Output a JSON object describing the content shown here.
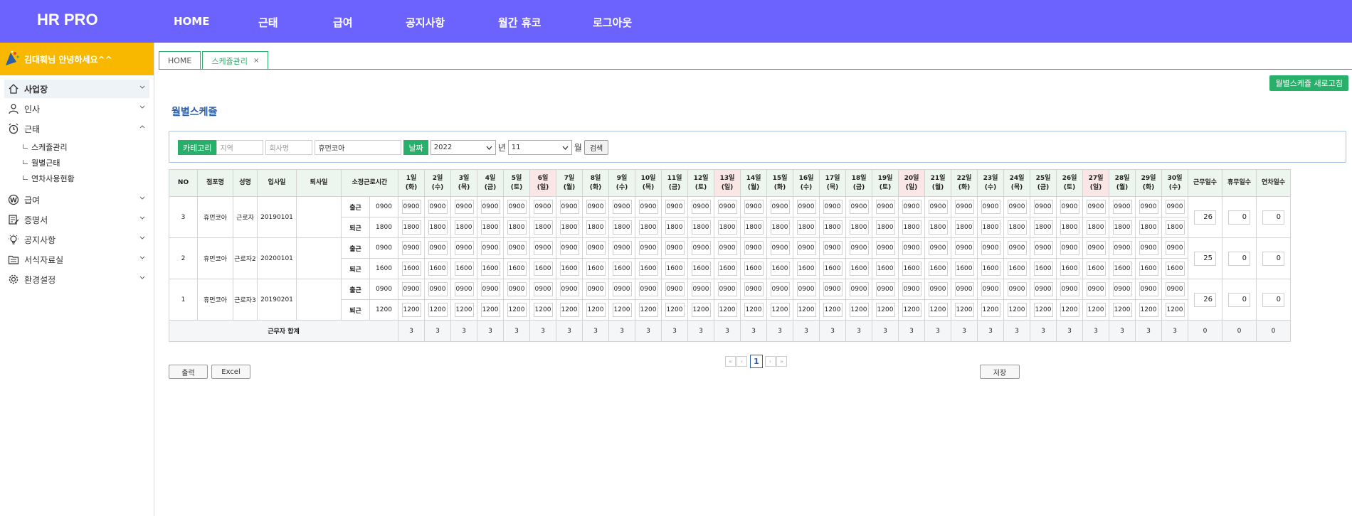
{
  "brand": "HR PRO",
  "topnav": [
    "HOME",
    "근태",
    "급여",
    "공지사항",
    "월간 휴코",
    "로그아웃"
  ],
  "sidebar": {
    "greeting": "김대훼님 안녕하세요^^",
    "items": [
      {
        "label": "사업장",
        "icon": "home-icon",
        "active": true
      },
      {
        "label": "인사",
        "icon": "person-icon"
      },
      {
        "label": "근태",
        "icon": "alarm-clock-icon",
        "expanded": true
      },
      {
        "label": "급여",
        "icon": "won-icon"
      },
      {
        "label": "증명서",
        "icon": "document-edit-icon"
      },
      {
        "label": "공지사항",
        "icon": "bulb-icon"
      },
      {
        "label": "서식자료실",
        "icon": "folder-icon"
      },
      {
        "label": "환경설정",
        "icon": "gear-icon"
      }
    ],
    "subitems": [
      "스케쥴관리",
      "월별근태",
      "연차사용현황"
    ]
  },
  "tabs": [
    {
      "label": "HOME"
    },
    {
      "label": "스케쥴관리",
      "close": "×"
    }
  ],
  "refresh_button": "월별스케쥴 새로고침",
  "page_title": "월별스케쥴",
  "search": {
    "category_label": "카테고리",
    "region_placeholder": "지역",
    "company_placeholder": "회사명",
    "store_value": "휴먼코아",
    "date_label": "날짜",
    "year_value": "2022",
    "year_suffix": "년",
    "month_value": "11",
    "month_suffix": "월",
    "search_button": "검색"
  },
  "table": {
    "headers": {
      "no": "NO",
      "store": "점포명",
      "name": "성명",
      "hire": "입사일",
      "leave": "퇴사일",
      "standard": "소정근로시간",
      "work_days": "근무일수",
      "off_days": "휴무일수",
      "annual_days": "연차일수"
    },
    "days": [
      {
        "d": "1일",
        "w": "(화)"
      },
      {
        "d": "2일",
        "w": "(수)"
      },
      {
        "d": "3일",
        "w": "(목)"
      },
      {
        "d": "4일",
        "w": "(금)"
      },
      {
        "d": "5일",
        "w": "(토)"
      },
      {
        "d": "6일",
        "w": "(일)",
        "hol": true
      },
      {
        "d": "7일",
        "w": "(월)"
      },
      {
        "d": "8일",
        "w": "(화)"
      },
      {
        "d": "9일",
        "w": "(수)"
      },
      {
        "d": "10일",
        "w": "(목)"
      },
      {
        "d": "11일",
        "w": "(금)"
      },
      {
        "d": "12일",
        "w": "(토)"
      },
      {
        "d": "13일",
        "w": "(일)",
        "hol": true
      },
      {
        "d": "14일",
        "w": "(월)"
      },
      {
        "d": "15일",
        "w": "(화)"
      },
      {
        "d": "16일",
        "w": "(수)"
      },
      {
        "d": "17일",
        "w": "(목)"
      },
      {
        "d": "18일",
        "w": "(금)"
      },
      {
        "d": "19일",
        "w": "(토)"
      },
      {
        "d": "20일",
        "w": "(일)",
        "hol": true
      },
      {
        "d": "21일",
        "w": "(월)"
      },
      {
        "d": "22일",
        "w": "(화)"
      },
      {
        "d": "23일",
        "w": "(수)"
      },
      {
        "d": "24일",
        "w": "(목)"
      },
      {
        "d": "25일",
        "w": "(금)"
      },
      {
        "d": "26일",
        "w": "(토)"
      },
      {
        "d": "27일",
        "w": "(일)",
        "hol": true
      },
      {
        "d": "28일",
        "w": "(월)"
      },
      {
        "d": "29일",
        "w": "(화)"
      },
      {
        "d": "30일",
        "w": "(수)"
      }
    ],
    "in_label": "출근",
    "out_label": "퇴근",
    "rows": [
      {
        "no": "3",
        "store": "휴먼코아",
        "name": "근로자",
        "hire": "20190101",
        "leave": "",
        "in": "0900",
        "out": "1800",
        "work_days": "26",
        "off_days": "0",
        "annual_days": "0"
      },
      {
        "no": "2",
        "store": "휴먼코아",
        "name": "근로자2",
        "hire": "20200101",
        "leave": "",
        "in": "0900",
        "out": "1600",
        "work_days": "25",
        "off_days": "0",
        "annual_days": "0"
      },
      {
        "no": "1",
        "store": "휴먼코아",
        "name": "근로자3",
        "hire": "20190201",
        "leave": "",
        "in": "0900",
        "out": "1200",
        "work_days": "26",
        "off_days": "0",
        "annual_days": "0"
      }
    ],
    "total_label": "근무자 합계",
    "day_total": "3",
    "totals": {
      "work_days": "0",
      "off_days": "0",
      "annual_days": "0"
    }
  },
  "pager": {
    "first": "«",
    "prev": "‹",
    "current": "1",
    "next": "›",
    "last": "»"
  },
  "buttons": {
    "print": "출력",
    "excel": "Excel",
    "save": "저장"
  },
  "colors": {
    "topbar": "#6c63ff",
    "greeting": "#f8b800",
    "accent_green": "#28b06a",
    "holiday_bg": "#fbe6e6"
  }
}
